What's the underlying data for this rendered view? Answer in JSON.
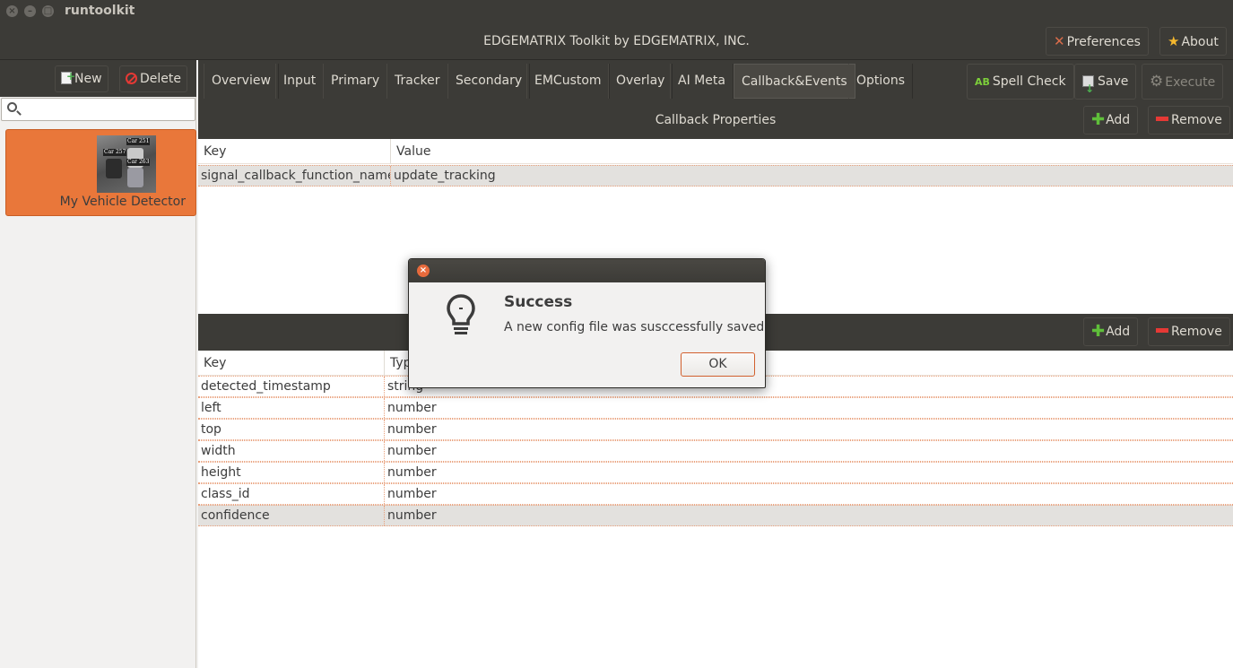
{
  "window": {
    "app_name": "runtoolkit",
    "title": "EDGEMATRIX Toolkit by EDGEMATRIX, INC."
  },
  "header": {
    "preferences_label": "Preferences",
    "about_label": "About"
  },
  "sidebar": {
    "new_label": "New",
    "delete_label": "Delete",
    "search_placeholder": "",
    "projects": [
      {
        "name": "My Vehicle Detector",
        "thumb_tags": [
          "Car 251",
          "Car 257",
          "Car 263"
        ]
      }
    ]
  },
  "tabs": [
    {
      "label": "Overview"
    },
    {
      "label": "Input"
    },
    {
      "label": "Primary"
    },
    {
      "label": "Tracker"
    },
    {
      "label": "Secondary"
    },
    {
      "label": "EMCustom"
    },
    {
      "label": "Overlay"
    },
    {
      "label": "AI Meta"
    },
    {
      "label": "Callback&Events",
      "active": true
    },
    {
      "label": "Options"
    }
  ],
  "toolbar": {
    "spell_check_label": "Spell Check",
    "spell_check_icon_text": "AB",
    "save_label": "Save",
    "execute_label": "Execute"
  },
  "callback_section": {
    "title": "Callback Properties",
    "add_label": "Add",
    "remove_label": "Remove",
    "columns": [
      "Key",
      "Value"
    ],
    "rows": [
      {
        "key": "signal_callback_function_name",
        "value": "update_tracking"
      }
    ]
  },
  "event_section": {
    "title": "",
    "add_label": "Add",
    "remove_label": "Remove",
    "columns": [
      "Key",
      "Typ"
    ],
    "rows": [
      {
        "key": "detected_timestamp",
        "type": "string"
      },
      {
        "key": "left",
        "type": "number"
      },
      {
        "key": "top",
        "type": "number"
      },
      {
        "key": "width",
        "type": "number"
      },
      {
        "key": "height",
        "type": "number"
      },
      {
        "key": "class_id",
        "type": "number"
      },
      {
        "key": "confidence",
        "type": "number"
      }
    ]
  },
  "dialog": {
    "heading": "Success",
    "message": "A new config file was susccessfully saved",
    "ok_label": "OK"
  },
  "colors": {
    "accent": "#e9773a",
    "header_bg": "#3c3b37",
    "window_bg": "#f2f1f0"
  }
}
